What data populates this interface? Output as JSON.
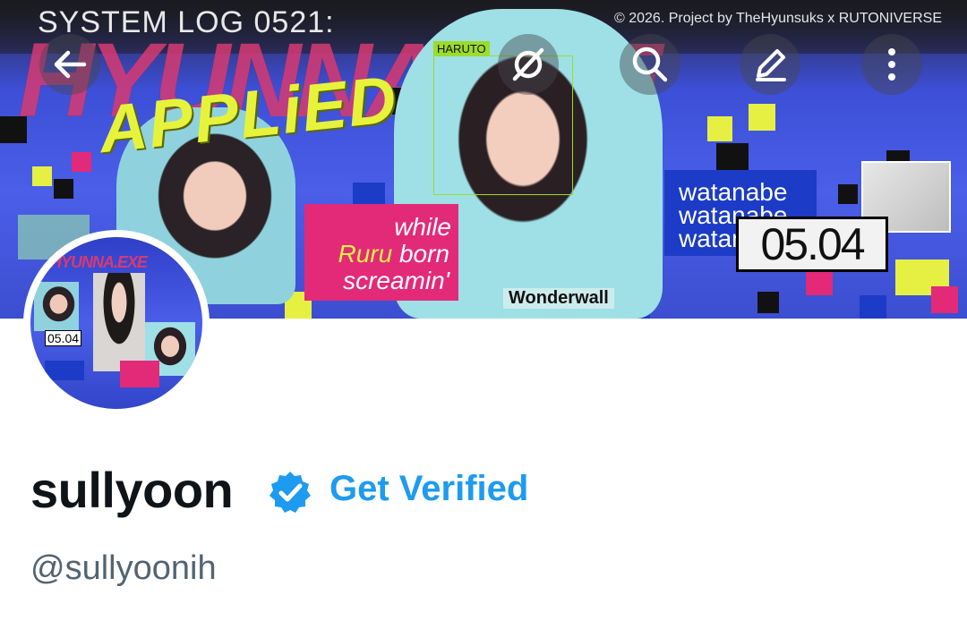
{
  "banner": {
    "system_log": "SYSTEM LOG 0521:",
    "copyright": "© 2026. Project by TheHyunsuks x RUTONIVERSE",
    "big_word": "HYUNNA.EXE",
    "applied": "APPLiED",
    "haruto_tag": "HARUTO",
    "pink_line1": "while",
    "pink_line2_a": "Ruru",
    "pink_line2_b": "born",
    "pink_line3": "screamin'",
    "blue_lines": [
      "watanabe",
      "watanabe",
      "watanabe"
    ],
    "date": "05.04",
    "shirt_text": "Wonderwall"
  },
  "nav": {
    "back_icon": "arrow-left-icon",
    "grok_icon": "grok-icon",
    "search_icon": "search-icon",
    "compose_icon": "pencil-icon",
    "more_icon": "more-vertical-icon"
  },
  "avatar": {
    "title": "HYUNNA.EXE",
    "date": "05.04"
  },
  "profile": {
    "display_name": "sullyoon",
    "get_verified_label": "Get Verified",
    "handle": "@sullyoonih",
    "verified_color": "#1d9bf0"
  },
  "colors": {
    "accent": "#1d9bf0",
    "text_primary": "#0f1419",
    "text_secondary": "#536471"
  }
}
